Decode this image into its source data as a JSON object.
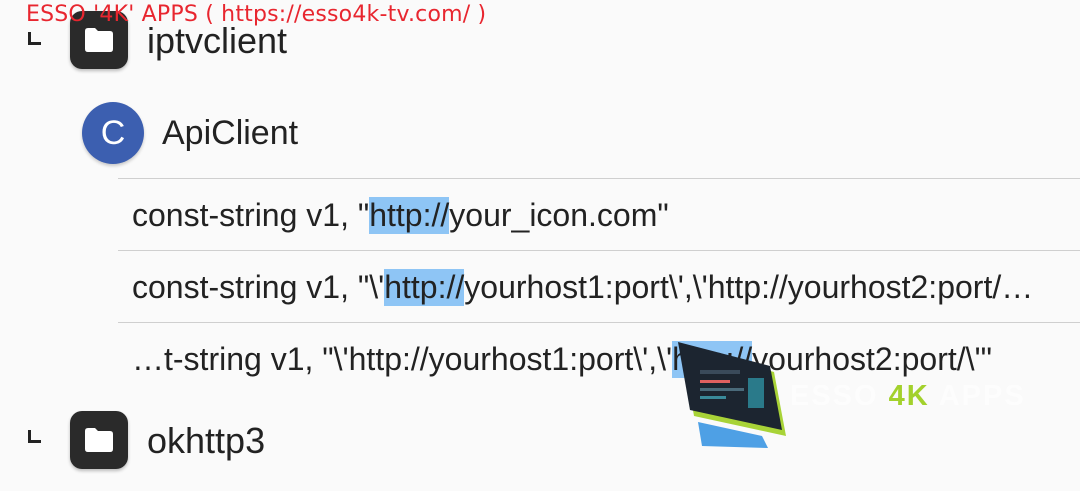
{
  "watermark": "ESSO '4K' APPS (  https://esso4k-tv.com/ )",
  "tree": {
    "folder1": {
      "label": "iptvclient",
      "icon": "folder-icon"
    },
    "class": {
      "letter": "C",
      "label": "ApiClient",
      "color": "#3c5fb0"
    },
    "results": [
      {
        "before": "const-string v1, \"",
        "match": "http://",
        "after": "your_icon.com\""
      },
      {
        "before": "const-string v1, \"\\'",
        "match": "http://",
        "after": "yourhost1:port\\',\\'http://yourhost2:port/…"
      },
      {
        "before": "…t-string v1, \"\\'http://yourhost1:port\\',\\'",
        "match": "http://",
        "after": "yourhost2:port/\\'\""
      }
    ],
    "folder2": {
      "label": "okhttp3",
      "icon": "folder-icon"
    }
  },
  "overlay_logo": {
    "part1": "ESSO ",
    "part2": "4K",
    "part3": " APPS"
  },
  "colors": {
    "highlight": "#8ec5f5",
    "class_badge": "#3c5fb0",
    "watermark": "#e8262f",
    "brand_green": "#a3d12c"
  }
}
